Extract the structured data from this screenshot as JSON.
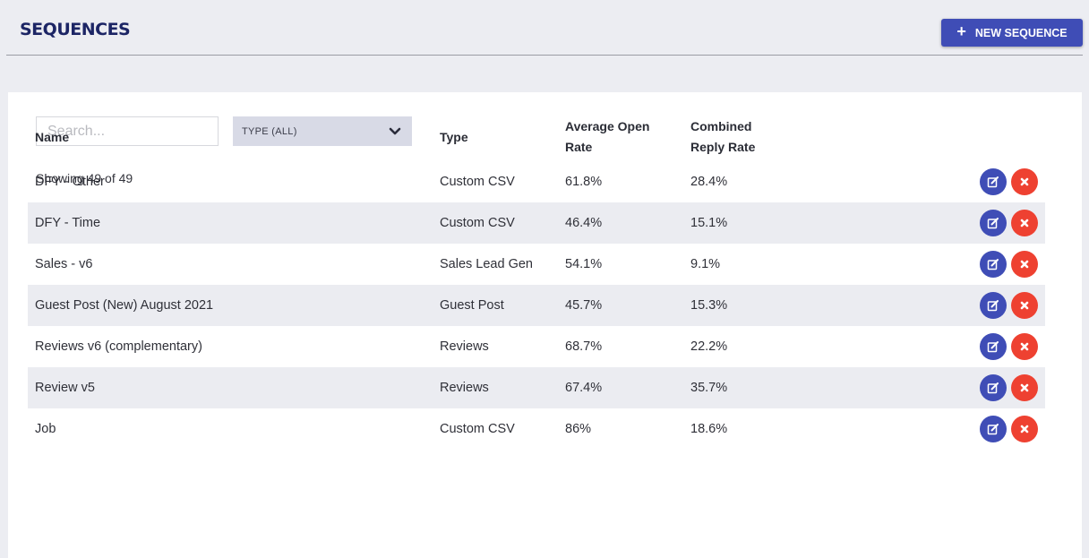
{
  "header": {
    "title": "SEQUENCES",
    "new_button_label": "NEW SEQUENCE",
    "accent_color": "#3f4db6"
  },
  "filters": {
    "search_placeholder": "Search...",
    "search_value": "",
    "type_selected": "TYPE (ALL)"
  },
  "summary": {
    "showing": "Showing 49 of 49"
  },
  "table": {
    "columns": [
      "Name",
      "Type",
      "Average Open Rate",
      "Combined Reply Rate"
    ],
    "rows": [
      {
        "name": "DFY - Other",
        "type": "Custom CSV",
        "open_rate": "61.8%",
        "reply_rate": "28.4%"
      },
      {
        "name": "DFY - Time",
        "type": "Custom CSV",
        "open_rate": "46.4%",
        "reply_rate": "15.1%"
      },
      {
        "name": "Sales - v6",
        "type": "Sales Lead Gen",
        "open_rate": "54.1%",
        "reply_rate": "9.1%"
      },
      {
        "name": "Guest Post (New) August 2021",
        "type": "Guest Post",
        "open_rate": "45.7%",
        "reply_rate": "15.3%"
      },
      {
        "name": "Reviews v6 (complementary)",
        "type": "Reviews",
        "open_rate": "68.7%",
        "reply_rate": "22.2%"
      },
      {
        "name": "Review v5",
        "type": "Reviews",
        "open_rate": "67.4%",
        "reply_rate": "35.7%"
      },
      {
        "name": "Job",
        "type": "Custom CSV",
        "open_rate": "86%",
        "reply_rate": "18.6%"
      }
    ],
    "row_actions": {
      "edit_icon": "edit-icon",
      "delete_icon": "close-icon",
      "edit_color": "#3f4db6",
      "delete_color": "#ee4131"
    }
  }
}
